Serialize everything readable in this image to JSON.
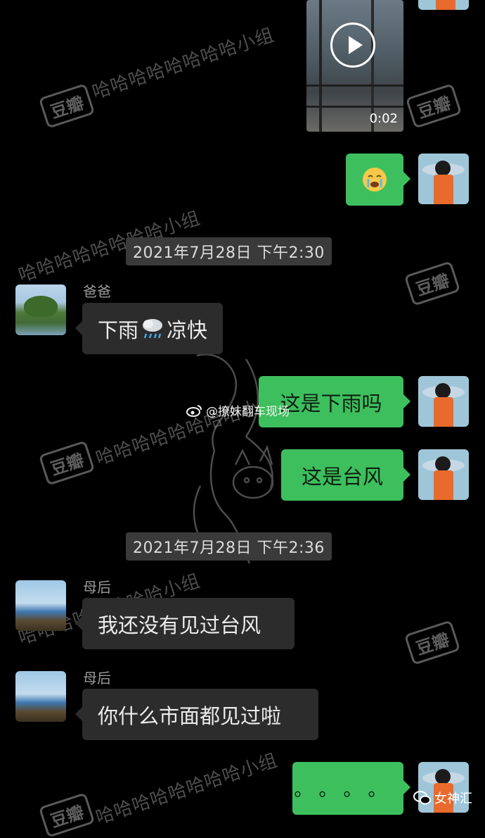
{
  "colors": {
    "background": "#000000",
    "outgoing_bubble": "#3dbf5e",
    "incoming_bubble": "#2c2c2c",
    "timestamp_pill": "#3a3a3a"
  },
  "video": {
    "duration": "0:02",
    "play_icon": "play-icon"
  },
  "messages_top": {
    "emoji_icon": "crying-face-emoji"
  },
  "timestamps": [
    "2021年7月28日 下午2:30",
    "2021年7月28日 下午2:36"
  ],
  "dad": {
    "name": "爸爸",
    "message_part1": "下雨",
    "message_icon": "rain-cloud-emoji",
    "message_part2": "凉快"
  },
  "outgoing": {
    "msg1": "这是下雨吗",
    "msg2": "这是台风",
    "msg_last": "。。。。"
  },
  "mom": {
    "name1": "母后",
    "message1": "我还没有见过台风",
    "name2": "母后",
    "message2": "你什么市面都见过啦"
  },
  "watermarks": {
    "douban": "豆瓣",
    "group": "哈哈哈哈哈哈哈哈小组",
    "weibo": "@撩妹翻车现场",
    "wechat": "女神汇"
  }
}
